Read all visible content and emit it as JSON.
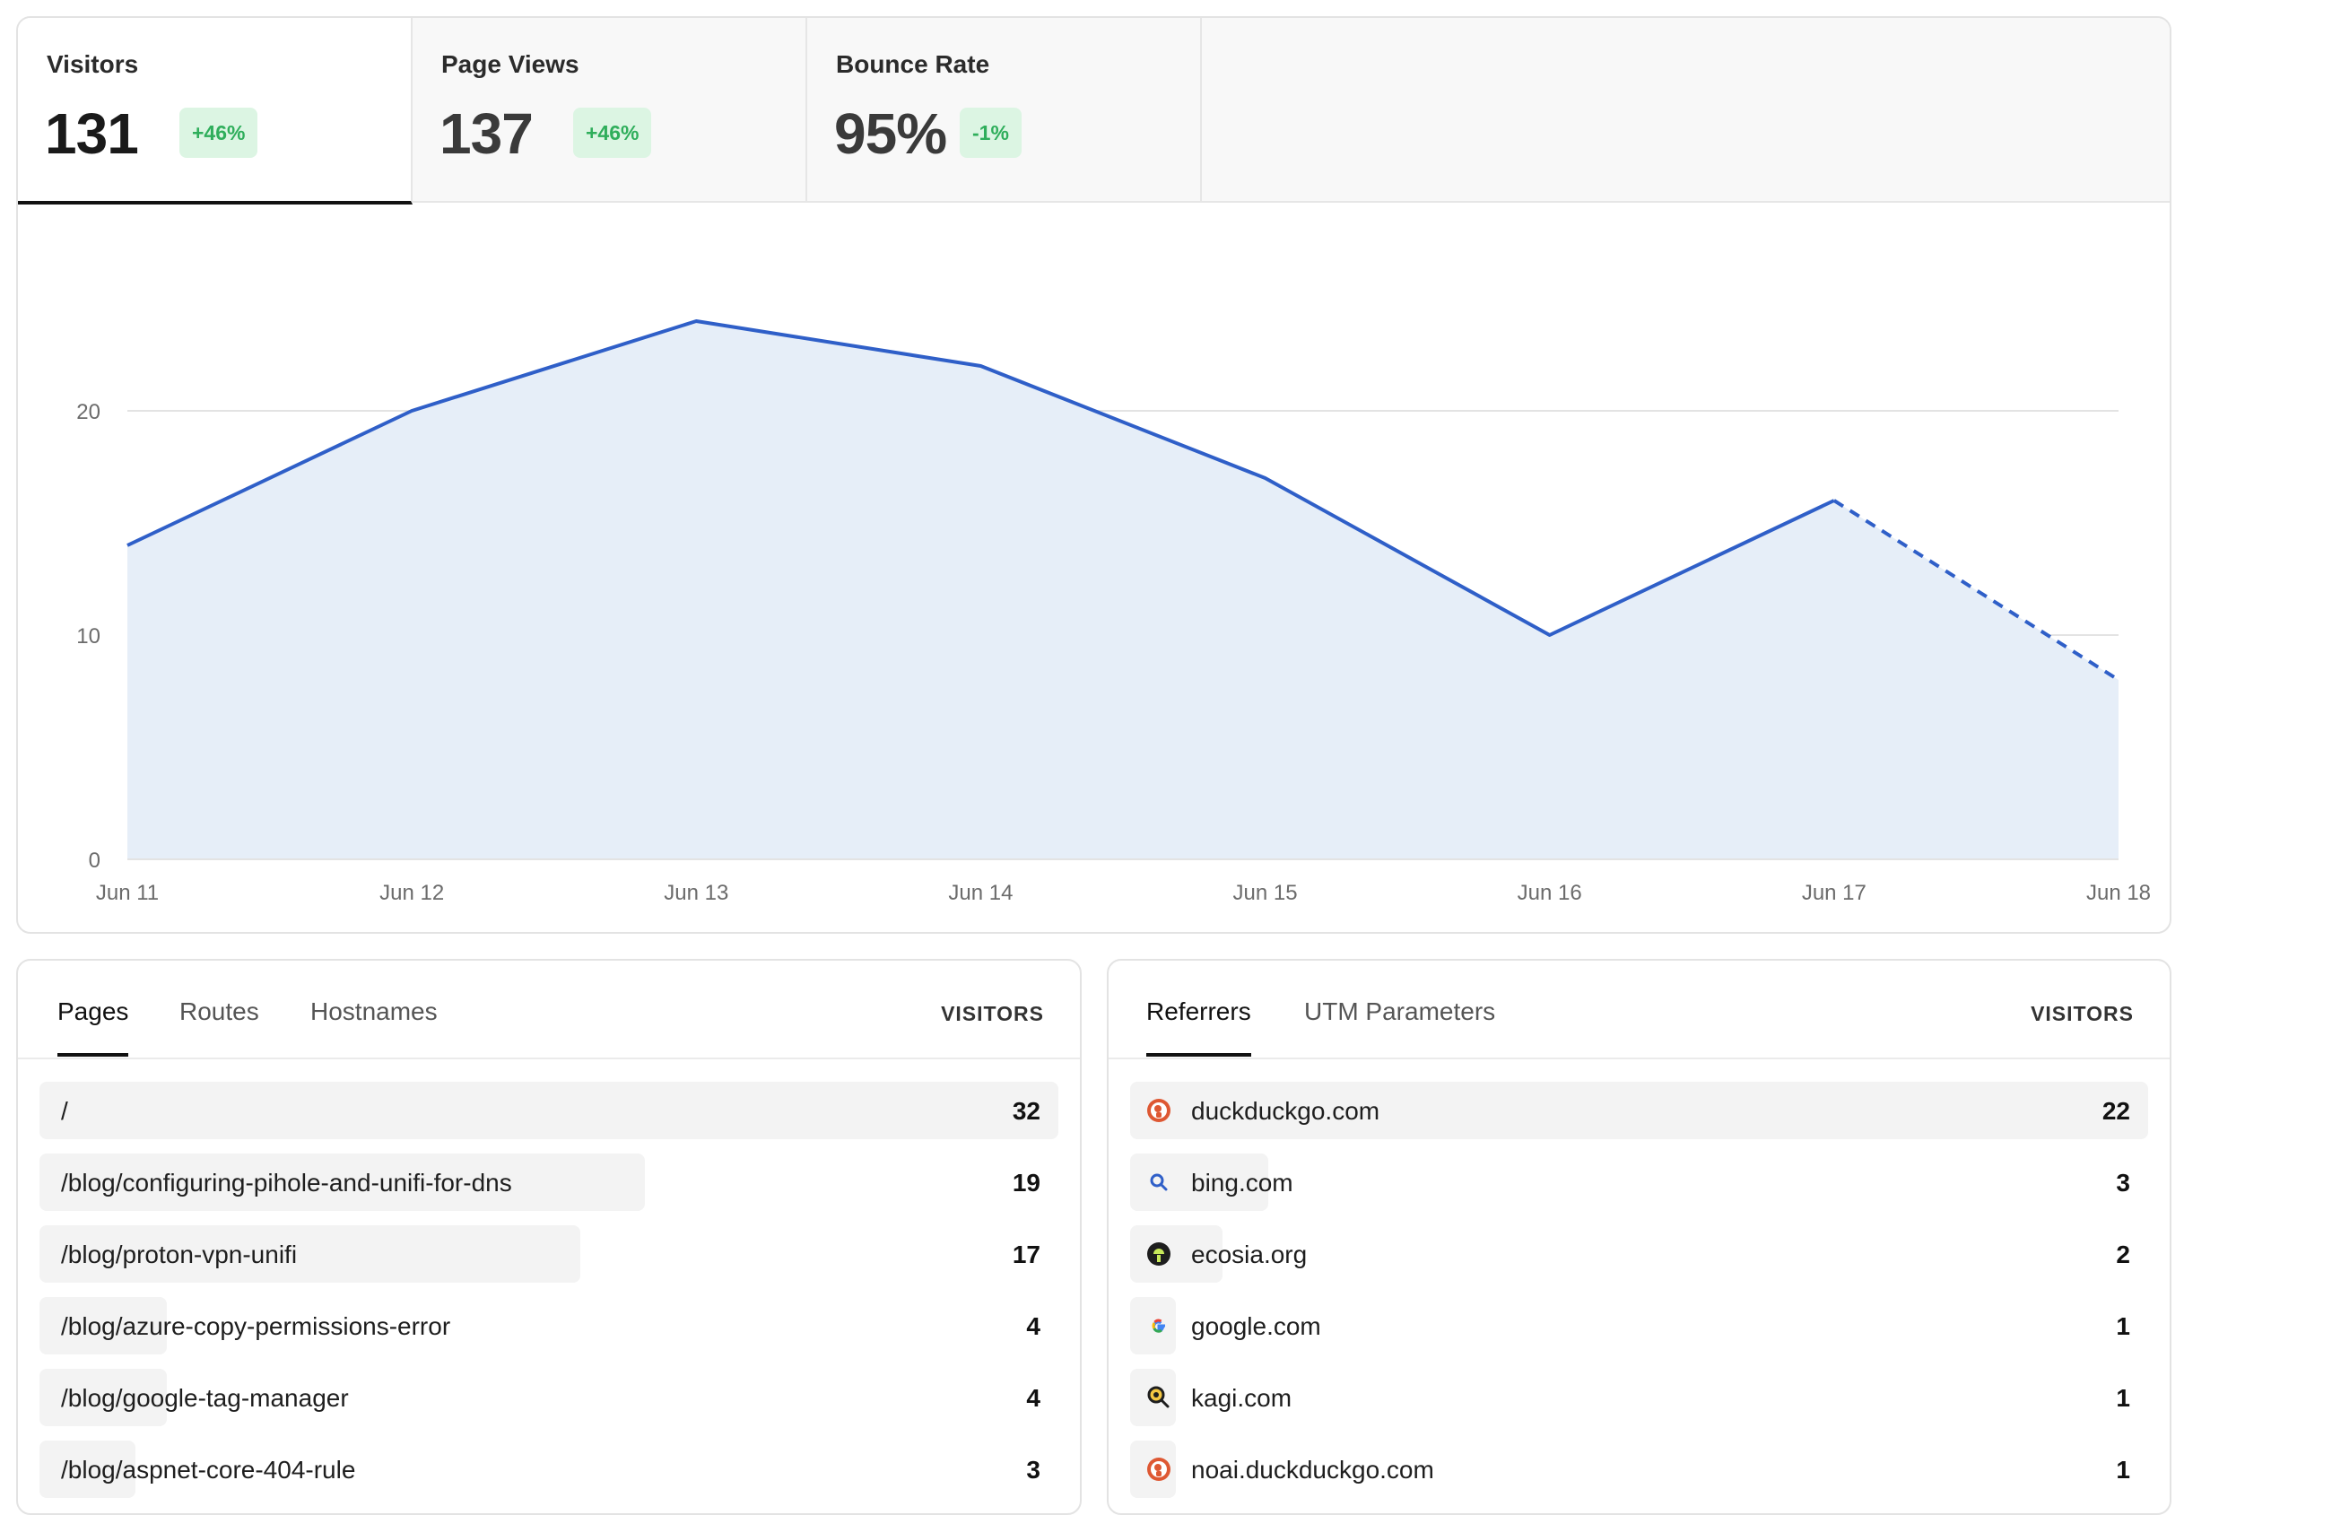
{
  "stats": [
    {
      "label": "Visitors",
      "value": "131",
      "change": "+46%",
      "active": true
    },
    {
      "label": "Page Views",
      "value": "137",
      "change": "+46%",
      "active": false
    },
    {
      "label": "Bounce Rate",
      "value": "95%",
      "change": "-1%",
      "active": false
    }
  ],
  "colors": {
    "line": "#2f5fc8",
    "area": "#e6eef8",
    "grid": "#e3e3e3",
    "badge_bg": "#dcf5e3",
    "badge_text": "#2fae5b"
  },
  "chart_data": {
    "type": "area",
    "x": [
      "Jun 11",
      "Jun 12",
      "Jun 13",
      "Jun 14",
      "Jun 15",
      "Jun 16",
      "Jun 17",
      "Jun 18"
    ],
    "series": [
      {
        "values": [
          14,
          20,
          24,
          22,
          17,
          10,
          16,
          8
        ]
      }
    ],
    "partial_last_segment": true,
    "y_ticks": [
      "0",
      "10",
      "20"
    ],
    "ylim": [
      0,
      24
    ],
    "grid": true
  },
  "pages": {
    "tabs": [
      "Pages",
      "Routes",
      "Hostnames"
    ],
    "active_tab": "Pages",
    "column_header": "VISITORS",
    "rows": [
      {
        "label": "/",
        "value": "32",
        "share": 1.0
      },
      {
        "label": "/blog/configuring-pihole-and-unifi-for-dns",
        "value": "19",
        "share": 0.594
      },
      {
        "label": "/blog/proton-vpn-unifi",
        "value": "17",
        "share": 0.531
      },
      {
        "label": "/blog/azure-copy-permissions-error",
        "value": "4",
        "share": 0.125
      },
      {
        "label": "/blog/google-tag-manager",
        "value": "4",
        "share": 0.125
      },
      {
        "label": "/blog/aspnet-core-404-rule",
        "value": "3",
        "share": 0.094
      }
    ]
  },
  "referrers": {
    "tabs": [
      "Referrers",
      "UTM Parameters"
    ],
    "active_tab": "Referrers",
    "column_header": "VISITORS",
    "rows": [
      {
        "label": "duckduckgo.com",
        "value": "22",
        "share": 1.0,
        "icon": "duckduckgo-icon"
      },
      {
        "label": "bing.com",
        "value": "3",
        "share": 0.136,
        "icon": "bing-search-icon"
      },
      {
        "label": "ecosia.org",
        "value": "2",
        "share": 0.091,
        "icon": "ecosia-icon"
      },
      {
        "label": "google.com",
        "value": "1",
        "share": 0.045,
        "icon": "google-icon"
      },
      {
        "label": "kagi.com",
        "value": "1",
        "share": 0.045,
        "icon": "kagi-icon"
      },
      {
        "label": "noai.duckduckgo.com",
        "value": "1",
        "share": 0.045,
        "icon": "duckduckgo-icon"
      }
    ]
  }
}
